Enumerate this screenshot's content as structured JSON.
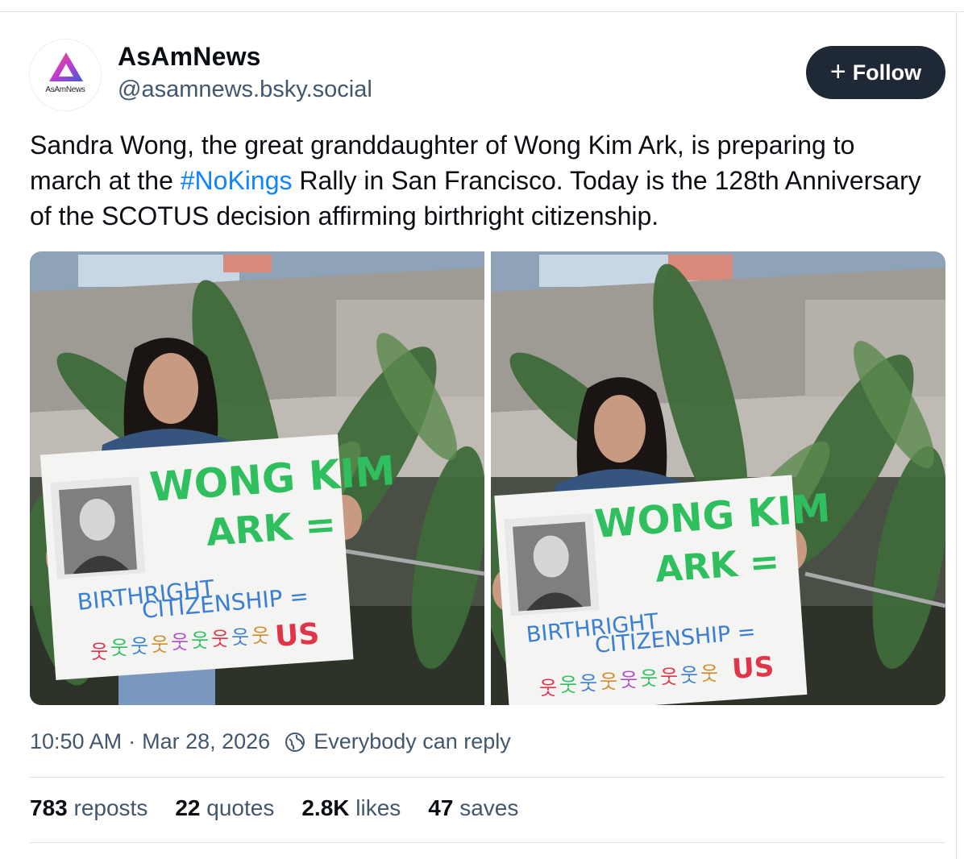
{
  "author": {
    "display_name": "AsAmNews",
    "handle": "@asamnews.bsky.social",
    "avatar_text": "AsAmNews"
  },
  "follow_button": {
    "label": "Follow"
  },
  "post": {
    "text_before": "Sandra Wong, the great granddaughter of Wong Kim Ark, is preparing to march at the ",
    "hashtag": "#NoKings",
    "text_after": " Rally in San Francisco. Today is the 128th Anniversary of the SCOTUS decision affirming birthright citizenship."
  },
  "photos": {
    "sign": {
      "line1": "WONG KIM",
      "line2": "ARK =",
      "line3": "BIRTHRIGHT",
      "line4": "CITIZENSHIP =",
      "line5": "US"
    }
  },
  "meta": {
    "time": "10:50 AM",
    "separator": "·",
    "date": "Mar 28, 2026",
    "reply_setting": "Everybody can reply"
  },
  "stats": [
    {
      "count": "783",
      "label": "reposts"
    },
    {
      "count": "22",
      "label": "quotes"
    },
    {
      "count": "2.8K",
      "label": "likes"
    },
    {
      "count": "47",
      "label": "saves"
    }
  ],
  "colors": {
    "follow_bg": "#1e2935",
    "hashtag": "#1083fe",
    "muted": "#42576c",
    "sign_green": "#2fbf5e",
    "sign_blue": "#3a7fd0",
    "sign_red": "#e0344a"
  }
}
